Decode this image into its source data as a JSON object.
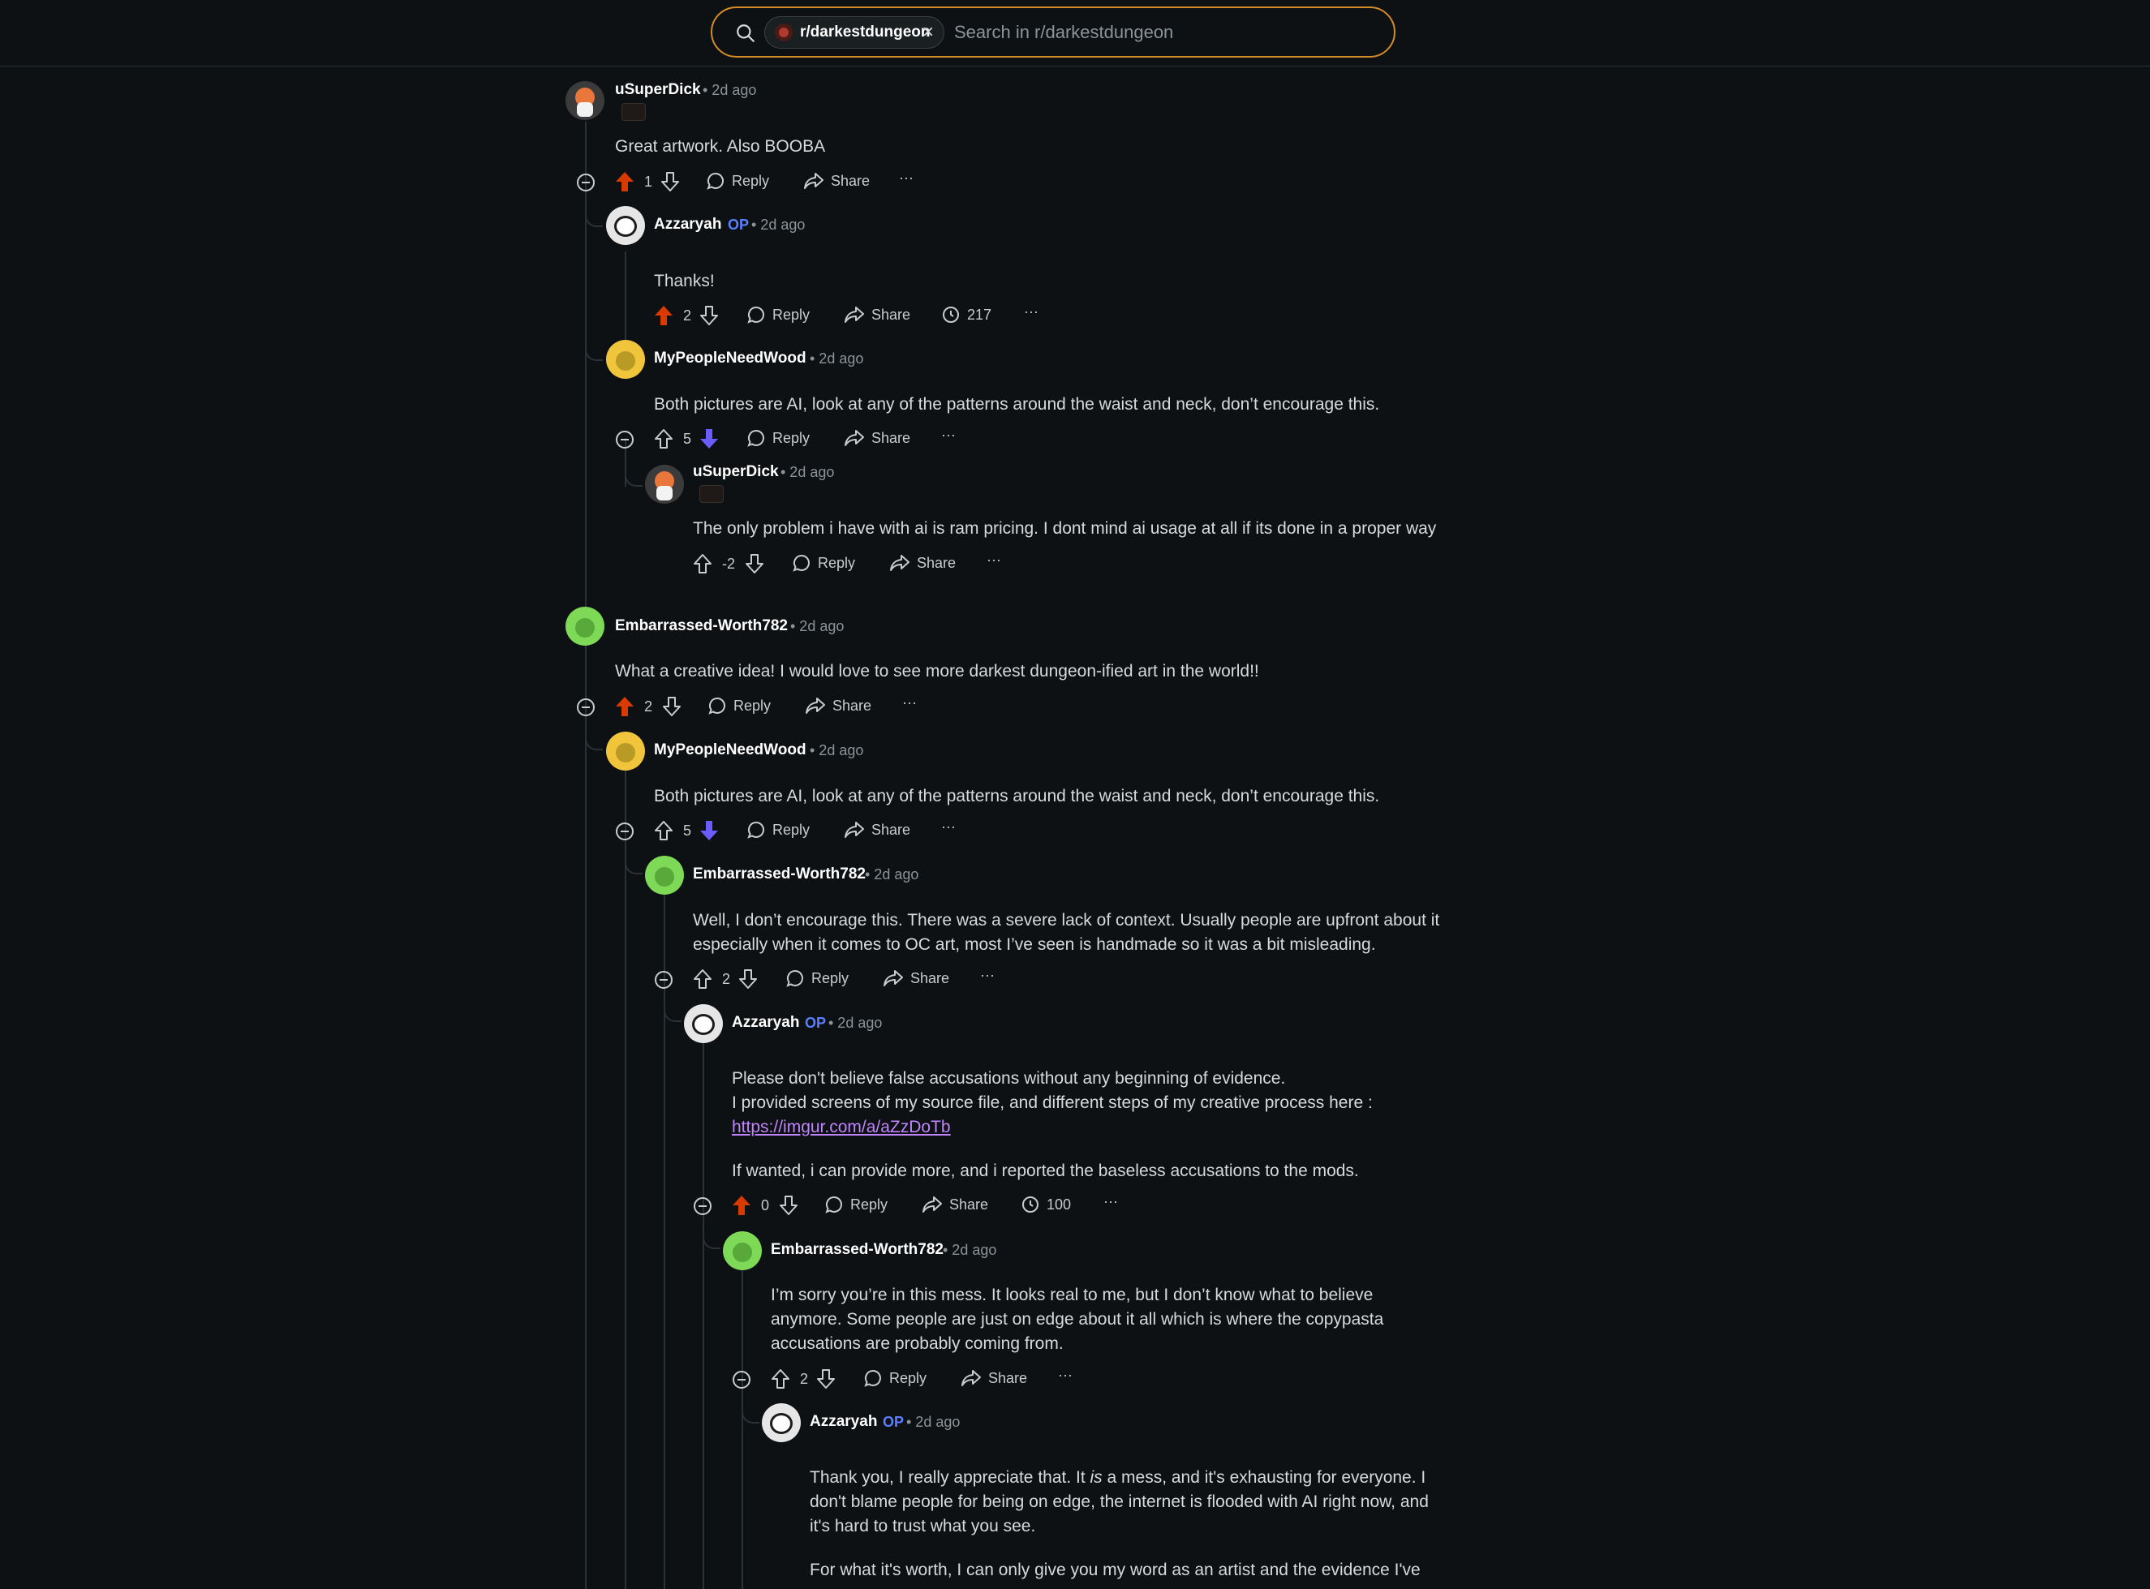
{
  "search": {
    "community": "r/darkestdungeon",
    "placeholder": "Search in r/darkestdungeon"
  },
  "labels": {
    "reply": "Reply",
    "share": "Share",
    "more": "···",
    "op": "OP"
  },
  "comments": [
    {
      "user": "uSuperDick",
      "time": "• 2d ago",
      "body": [
        "Great artwork. Also BOOBA"
      ],
      "score": "1",
      "vote": "up"
    },
    {
      "user": "Azzaryah",
      "op": true,
      "time": "• 2d ago",
      "body": [
        "Thanks!"
      ],
      "score": "2",
      "vote": "up",
      "views": "217"
    },
    {
      "user": "MyPeopleNeedWood",
      "time": "• 2d ago",
      "body": [
        "Both pictures are AI, look at any of the patterns around the waist and neck, don’t encourage this."
      ],
      "score": "5",
      "vote": "down"
    },
    {
      "user": "uSuperDick",
      "time": "• 2d ago",
      "body": [
        "The only problem i have with ai is ram pricing. I dont mind ai usage at all if its done in a proper way"
      ],
      "score": "-2",
      "vote": "none"
    },
    {
      "user": "Embarrassed-Worth782",
      "time": "• 2d ago",
      "body": [
        "What a creative idea! I would love to see more darkest dungeon-ified art in the world!!"
      ],
      "score": "2",
      "vote": "up"
    },
    {
      "user": "MyPeopleNeedWood",
      "time": "• 2d ago",
      "body": [
        "Both pictures are AI, look at any of the patterns around the waist and neck, don’t encourage this."
      ],
      "score": "5",
      "vote": "down"
    },
    {
      "user": "Embarrassed-Worth782",
      "time": "• 2d ago",
      "body": [
        "Well, I don’t encourage this. There was a severe lack of context. Usually people are upfront about it",
        "especially when it comes to OC art, most I’ve seen is handmade so it was a bit misleading."
      ],
      "score": "2",
      "vote": "none"
    },
    {
      "user": "Azzaryah",
      "op": true,
      "time": "• 2d ago",
      "body": [
        "Please don't believe false accusations without any beginning of evidence.",
        "I provided screens of my source file, and different steps of my creative process here :"
      ],
      "link": "https://imgur.com/a/aZzDoTb",
      "body2": "If wanted, i can provide more, and i reported the baseless accusations to the mods.",
      "score": "0",
      "vote": "up",
      "views": "100"
    },
    {
      "user": "Embarrassed-Worth782",
      "time": "• 2d ago",
      "body": [
        "I’m sorry you’re in this mess. It looks real to me, but I don’t know what to believe",
        "anymore. Some people are just on edge about it all which is where the copypasta",
        "accusations are probably coming from."
      ],
      "score": "2",
      "vote": "none"
    },
    {
      "user": "Azzaryah",
      "op": true,
      "time": "• 2d ago",
      "body_parts": [
        "Thank you, I really appreciate that. It ",
        "is",
        " a mess, and it's exhausting for everyone. I"
      ],
      "body": [
        "don't blame people for being on edge, the internet is flooded with AI right now, and",
        "it's hard to trust what you see."
      ],
      "body2": "For what it's worth, I can only give you my word as an artist and the evidence I've"
    }
  ],
  "colors": {
    "upvote": "#d93a00",
    "downvote": "#6a5cff",
    "accent": "#d38c29"
  }
}
